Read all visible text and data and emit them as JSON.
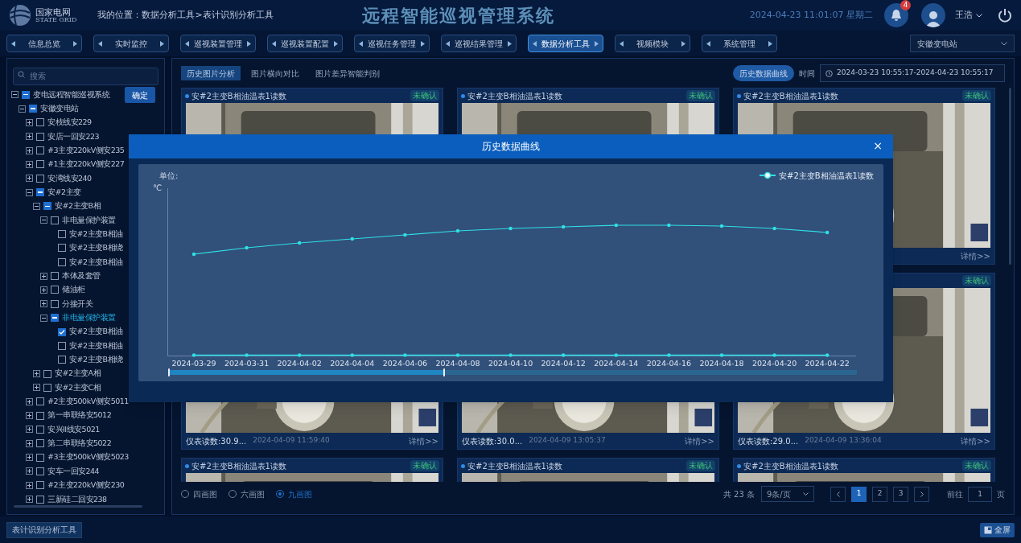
{
  "header": {
    "logo_name": "国家电网",
    "logo_sub": "STATE GRID",
    "breadcrumb": "我的位置：数据分析工具>表计识别分析工具",
    "title": "远程智能巡视管理系统",
    "datetime": "2024-04-23 11:01:07 星期二",
    "notifications": "4",
    "user": "王浩"
  },
  "nav": [
    {
      "label": "信息总览",
      "selected": false
    },
    {
      "label": "实时监控",
      "selected": false
    },
    {
      "label": "巡视装置管理",
      "selected": false
    },
    {
      "label": "巡视装置配置",
      "selected": false
    },
    {
      "label": "巡视任务管理",
      "selected": false
    },
    {
      "label": "巡视结果管理",
      "selected": false
    },
    {
      "label": "数据分析工具",
      "selected": true
    },
    {
      "label": "视频模块",
      "selected": false
    },
    {
      "label": "系统管理",
      "selected": false
    }
  ],
  "station_select": "安徽变电站",
  "sidebar": {
    "search_placeholder": "搜索",
    "confirm": "确定",
    "tree": [
      {
        "label": "变电远程智能巡视系统",
        "partial": true,
        "expanded": true,
        "selected": false,
        "children": [
          {
            "label": "安徽变电站",
            "partial": true,
            "expanded": true,
            "selected": false,
            "children": [
              {
                "label": "安枝线安229",
                "checked": false,
                "partial": false,
                "expanded": false,
                "selected": false
              },
              {
                "label": "安店一回安223",
                "checked": false,
                "partial": false,
                "expanded": false,
                "selected": false
              },
              {
                "label": "#3主变220kV侧安235",
                "checked": false,
                "partial": false,
                "expanded": false,
                "selected": false
              },
              {
                "label": "#1主变220kV侧安227",
                "checked": false,
                "partial": false,
                "expanded": false,
                "selected": false
              },
              {
                "label": "安湾线安240",
                "checked": false,
                "partial": false,
                "expanded": false,
                "selected": false
              },
              {
                "label": "安#2主变",
                "partial": true,
                "expanded": true,
                "selected": false,
                "children": [
                  {
                    "label": "安#2主变B相",
                    "partial": true,
                    "expanded": true,
                    "selected": false,
                    "children": [
                      {
                        "label": "非电量保护装置",
                        "checked": false,
                        "partial": false,
                        "expanded": true,
                        "selected": false,
                        "children": [
                          {
                            "label": "安#2主变B相油",
                            "checked": false,
                            "partial": false,
                            "selected": false
                          },
                          {
                            "label": "安#2主变B相绕",
                            "checked": false,
                            "partial": false,
                            "selected": false
                          },
                          {
                            "label": "安#2主变B相油",
                            "checked": false,
                            "partial": false,
                            "selected": false
                          }
                        ]
                      },
                      {
                        "label": "本体及套管",
                        "checked": false,
                        "partial": false,
                        "expanded": false,
                        "selected": false
                      },
                      {
                        "label": "储油柜",
                        "checked": false,
                        "partial": false,
                        "expanded": false,
                        "selected": false
                      },
                      {
                        "label": "分接开关",
                        "checked": false,
                        "partial": false,
                        "expanded": false,
                        "selected": false
                      },
                      {
                        "label": "非电量保护装置",
                        "partial": true,
                        "expanded": true,
                        "selected": true,
                        "children": [
                          {
                            "label": "安#2主变B相油",
                            "checked": true,
                            "selected": false
                          },
                          {
                            "label": "安#2主变B相油",
                            "checked": false,
                            "partial": false,
                            "selected": false
                          },
                          {
                            "label": "安#2主变B相绕",
                            "checked": false,
                            "partial": false,
                            "selected": false
                          }
                        ]
                      }
                    ]
                  },
                  {
                    "label": "安#2主变A相",
                    "checked": false,
                    "partial": false,
                    "expanded": false,
                    "selected": false
                  },
                  {
                    "label": "安#2主变C相",
                    "checked": false,
                    "partial": false,
                    "expanded": false,
                    "selected": false
                  }
                ]
              },
              {
                "label": "#2主变500kV侧安5011",
                "checked": false,
                "partial": false,
                "expanded": false,
                "selected": false
              },
              {
                "label": "第一串联络安5012",
                "checked": false,
                "partial": false,
                "expanded": false,
                "selected": false
              },
              {
                "label": "安兴II线安5021",
                "checked": false,
                "partial": false,
                "expanded": false,
                "selected": false
              },
              {
                "label": "第二串联络安5022",
                "checked": false,
                "partial": false,
                "expanded": false,
                "selected": false
              },
              {
                "label": "#3主变500kV侧安5023",
                "checked": false,
                "partial": false,
                "expanded": false,
                "selected": false
              },
              {
                "label": "安车一回安244",
                "checked": false,
                "partial": false,
                "expanded": false,
                "selected": false
              },
              {
                "label": "#2主变220kV侧安230",
                "checked": false,
                "partial": false,
                "expanded": false,
                "selected": false
              },
              {
                "label": "三新硅二回安238",
                "checked": false,
                "partial": false,
                "expanded": false,
                "selected": false
              }
            ]
          }
        ]
      }
    ]
  },
  "content": {
    "tabs": [
      {
        "label": "历史图片分析",
        "selected": true
      },
      {
        "label": "图片横向对比",
        "selected": false
      },
      {
        "label": "图片差异智能判别",
        "selected": false
      }
    ],
    "curve_button": "历史数据曲线",
    "time_label": "时间",
    "time_range": "2024-03-23 10:55:17-2024-04-23 10:55:17",
    "card_rows": [
      [
        {
          "title": "安#2主变B相油温表1读数",
          "badge": "未确认"
        },
        {
          "title": "安#2主变B相油温表1读数",
          "badge": "未确认"
        },
        {
          "title": "安#2主变B相油温表1读数",
          "badge": "未确认",
          "detail": "详情>>"
        }
      ],
      [
        {
          "reading": "仪表读数:30.9...",
          "time": "2024-04-09 11:59:40",
          "detail": "详情>>"
        },
        {
          "reading": "仪表读数:30.0...",
          "time": "2024-04-09 13:05:37",
          "detail": "详情>>"
        },
        {
          "badge": "未确认",
          "reading": "仪表读数:29.0...",
          "time": "2024-04-09 13:36:04",
          "detail": "详情>>"
        }
      ],
      [
        {
          "title": "安#2主变B相油温表1读数",
          "badge": "未确认"
        },
        {
          "title": "安#2主变B相油温表1读数",
          "badge": "未确认"
        },
        {
          "title": "安#2主变B相油温表1读数",
          "badge": "未确认"
        }
      ]
    ],
    "layouts": [
      {
        "label": "四画图",
        "selected": false
      },
      {
        "label": "六画图",
        "selected": false
      },
      {
        "label": "九画图",
        "selected": true
      }
    ],
    "pagination": {
      "total": "共 23 条",
      "page_size": "9条/页",
      "pages": [
        {
          "label": "1",
          "selected": true
        },
        {
          "label": "2",
          "selected": false
        },
        {
          "label": "3",
          "selected": false
        }
      ],
      "goto_label": "前往",
      "goto_value": "1",
      "goto_suffix": "页"
    }
  },
  "bottom": {
    "tool_tab": "表计识别分析工具",
    "fullscreen": "全屏"
  },
  "modal": {
    "title": "历史数据曲线",
    "close": "×",
    "zoom": {
      "level": 0.4
    },
    "unit_label": "单位:",
    "unit": "℃",
    "legend": "安#2主变B相油温表1读数",
    "x_labels": [
      "2024-03-29",
      "2024-03-31",
      "2024-04-02",
      "2024-04-04",
      "2024-04-06",
      "2024-04-08",
      "2024-04-10",
      "2024-04-12",
      "2024-04-14",
      "2024-04-16",
      "2024-04-18",
      "2024-04-20",
      "2024-04-22"
    ]
  }
}
